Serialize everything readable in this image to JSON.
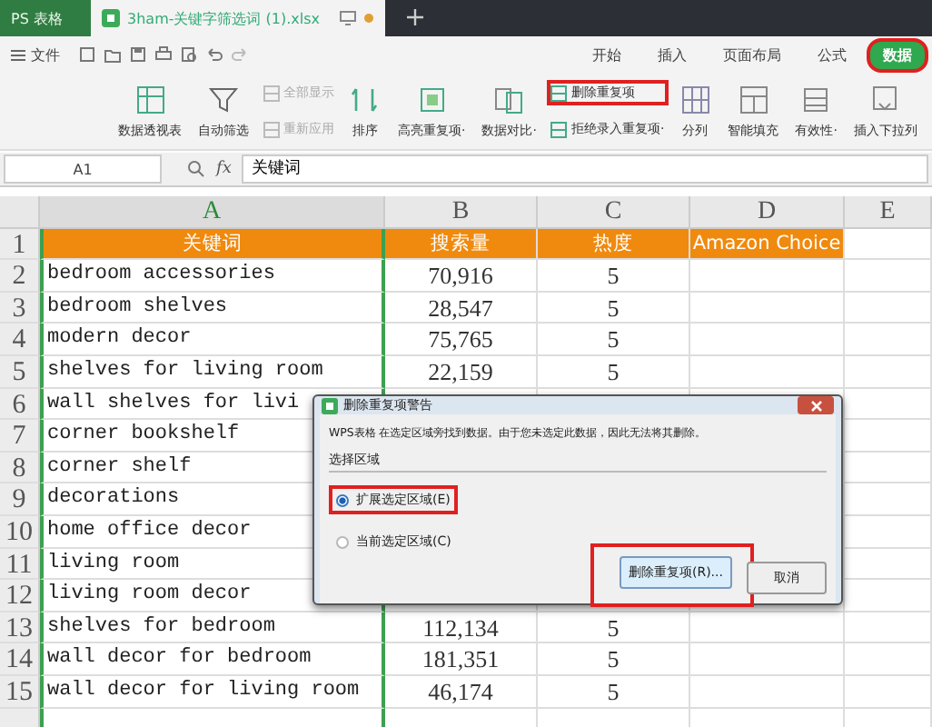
{
  "title_tabs": [
    {
      "label": "PS 表格",
      "kind": "app",
      "selected": false
    },
    {
      "label": "3ham-关键字筛选词 (1).xlsx",
      "kind": "file",
      "selected": true
    }
  ],
  "menu": {
    "file": "文件"
  },
  "ribbon_tabs": [
    {
      "label": "开始",
      "selected": false,
      "highlighted": false
    },
    {
      "label": "插入",
      "selected": false,
      "highlighted": false
    },
    {
      "label": "页面布局",
      "selected": false,
      "highlighted": false
    },
    {
      "label": "公式",
      "selected": false,
      "highlighted": false
    },
    {
      "label": "数据",
      "selected": true,
      "highlighted": true
    }
  ],
  "ribbon": [
    {
      "label": "数据透视表",
      "kind": "large",
      "disabled": false,
      "highlighted": false
    },
    {
      "label": "自动筛选",
      "kind": "large",
      "disabled": false,
      "highlighted": false
    },
    {
      "label": "全部显示",
      "kind": "small",
      "disabled": true,
      "highlighted": false
    },
    {
      "label": "重新应用",
      "kind": "small",
      "disabled": true,
      "highlighted": false
    },
    {
      "label": "排序",
      "kind": "large",
      "disabled": false,
      "highlighted": false
    },
    {
      "label": "高亮重复项·",
      "kind": "large",
      "disabled": false,
      "highlighted": false
    },
    {
      "label": "数据对比·",
      "kind": "large",
      "disabled": false,
      "highlighted": false
    },
    {
      "label": "删除重复项",
      "kind": "small",
      "disabled": false,
      "highlighted": true
    },
    {
      "label": "拒绝录入重复项·",
      "kind": "small",
      "disabled": false,
      "highlighted": false
    },
    {
      "label": "分列",
      "kind": "large",
      "disabled": false,
      "highlighted": false
    },
    {
      "label": "智能填充",
      "kind": "large",
      "disabled": false,
      "highlighted": false
    },
    {
      "label": "有效性·",
      "kind": "large",
      "disabled": false,
      "highlighted": false
    },
    {
      "label": "插入下拉列",
      "kind": "large",
      "disabled": false,
      "highlighted": false
    }
  ],
  "formula_bar": {
    "cell": "A1",
    "fx": "fx",
    "value": "关键词"
  },
  "sheet": {
    "columns": [
      "A",
      "B",
      "C",
      "D",
      "E"
    ],
    "header_num": "1",
    "header": [
      "关键词",
      "搜索量",
      "热度",
      "Amazon Choice"
    ],
    "rows": [
      {
        "num": "2",
        "cells": [
          "bedroom accessories",
          "70,916",
          "5"
        ]
      },
      {
        "num": "3",
        "cells": [
          "bedroom shelves",
          "28,547",
          "5"
        ]
      },
      {
        "num": "4",
        "cells": [
          "modern decor",
          "75,765",
          "5"
        ]
      },
      {
        "num": "5",
        "cells": [
          "shelves for living room",
          "22,159",
          "5"
        ]
      },
      {
        "num": "6",
        "cells": [
          "wall shelves for livi"
        ]
      },
      {
        "num": "7",
        "cells": [
          "corner bookshelf"
        ]
      },
      {
        "num": "8",
        "cells": [
          "corner shelf"
        ]
      },
      {
        "num": "9",
        "cells": [
          "decorations"
        ]
      },
      {
        "num": "10",
        "cells": [
          "home office decor"
        ]
      },
      {
        "num": "11",
        "cells": [
          "living room"
        ]
      },
      {
        "num": "12",
        "cells": [
          "living room decor"
        ]
      },
      {
        "num": "13",
        "cells": [
          "shelves for bedroom",
          "112,134",
          "5"
        ]
      },
      {
        "num": "14",
        "cells": [
          "wall decor for bedroom",
          "181,351",
          "5"
        ]
      },
      {
        "num": "15",
        "cells": [
          "wall decor for living room",
          "46,174",
          "5"
        ]
      }
    ]
  },
  "dialog": {
    "title": "删除重复项警告",
    "message": "WPS表格 在选定区域旁找到数据。由于您未选定此数据，因此无法将其删除。",
    "group_label": "选择区域",
    "options": [
      {
        "label": "扩展选定区域(E)",
        "selected": true,
        "highlighted": true
      },
      {
        "label": "当前选定区域(C)",
        "selected": false,
        "highlighted": false
      }
    ],
    "buttons": [
      {
        "label": "删除重复项(R)...",
        "kind": "primary",
        "highlighted": true
      },
      {
        "label": "取消",
        "kind": "cancel",
        "highlighted": false
      }
    ]
  }
}
